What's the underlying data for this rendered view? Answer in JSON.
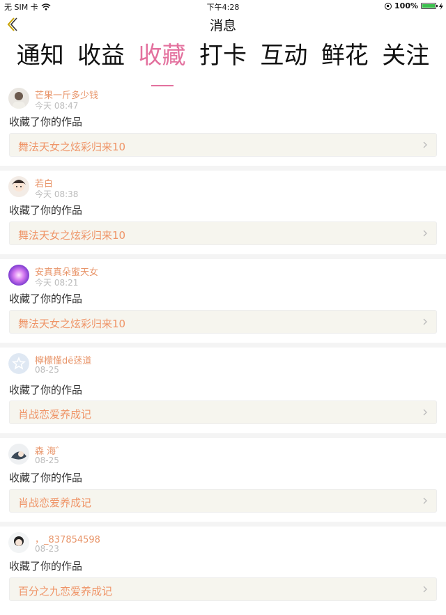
{
  "status_bar": {
    "carrier": "无 SIM 卡",
    "time": "下午4:28",
    "battery": "100%"
  },
  "nav": {
    "title": "消息"
  },
  "tabs": [
    {
      "label": "通知"
    },
    {
      "label": "收益"
    },
    {
      "label": "收藏",
      "active": true
    },
    {
      "label": "打卡"
    },
    {
      "label": "互动"
    },
    {
      "label": "鲜花"
    },
    {
      "label": "关注"
    }
  ],
  "colors": {
    "accent_pink": "#e3719e",
    "name_orange": "#e8956a",
    "work_orange": "#ef9467",
    "work_bg": "#f6f5ee"
  },
  "notifications": [
    {
      "user": "芒果一斤多少钱",
      "time": "今天 08:47",
      "action": "收藏了你的作品",
      "work": "舞法天女之炫彩归来10",
      "avatar_icon": "avatar-photo"
    },
    {
      "user": "若白",
      "time": "今天 08:38",
      "action": "收藏了你的作品",
      "work": "舞法天女之炫彩归来10",
      "avatar_icon": "avatar-photo"
    },
    {
      "user": "安真真朵蜜天女",
      "time": "今天 08:21",
      "action": "收藏了你的作品",
      "work": "舞法天女之炫彩归来10",
      "avatar_icon": "avatar-photo"
    },
    {
      "user": "檸檬慬dē蒁道",
      "time": "08-25",
      "action": "收藏了你的作品",
      "work": "肖战恋爱养成记",
      "avatar_icon": "default-star-avatar"
    },
    {
      "user": "森 海゛",
      "time": "08-25",
      "action": "收藏了你的作品",
      "work": "肖战恋爱养成记",
      "avatar_icon": "avatar-photo"
    },
    {
      "user": "，_837854598",
      "time": "08-23",
      "action": "收藏了你的作品",
      "work": "百分之九恋爱养成记",
      "avatar_icon": "avatar-photo"
    }
  ]
}
